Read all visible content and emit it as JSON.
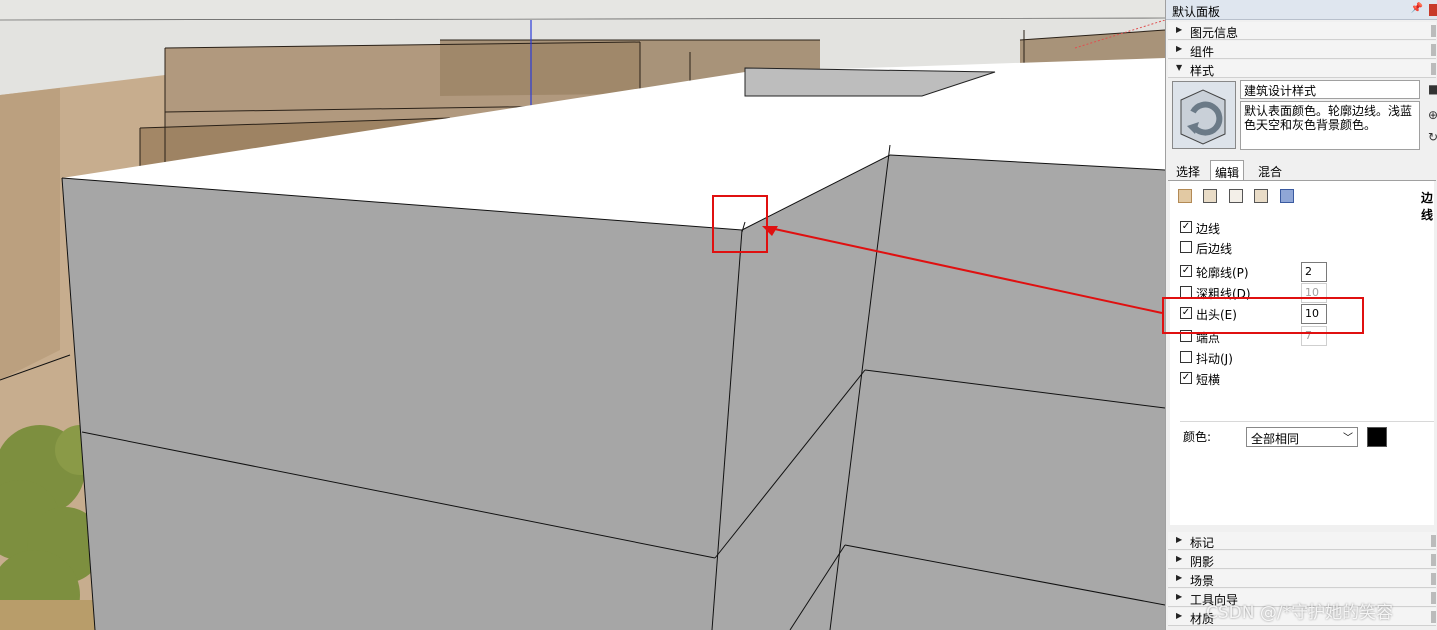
{
  "panel": {
    "title": "默认面板",
    "pin_icon": "📌",
    "trays_top": [
      {
        "label": "图元信息",
        "state": "collapsed"
      },
      {
        "label": "组件",
        "state": "collapsed"
      },
      {
        "label": "样式",
        "state": "expanded"
      }
    ],
    "style": {
      "name": "建筑设计样式",
      "description": "默认表面颜色。轮廓边线。浅蓝色天空和灰色背景颜色。"
    },
    "tabs": [
      {
        "label": "选择",
        "active": false
      },
      {
        "label": "编辑",
        "active": true
      },
      {
        "label": "混合",
        "active": false
      }
    ],
    "edit_header": "边线",
    "edge_options": [
      {
        "label": "边线",
        "checked": true
      },
      {
        "label": "后边线",
        "checked": false
      },
      {
        "label": "轮廓线(P)",
        "checked": true,
        "value": "2"
      },
      {
        "label": "深粗线(D)",
        "checked": false,
        "value": "10",
        "disabled": true
      },
      {
        "label": "出头(E)",
        "checked": true,
        "value": "10"
      },
      {
        "label": "端点",
        "checked": false,
        "value": "7",
        "disabled": true
      },
      {
        "label": "抖动(J)",
        "checked": false
      },
      {
        "label": "短横",
        "checked": true
      }
    ],
    "color_label": "颜色:",
    "color_mode": "全部相同",
    "color_swatch": "#000000",
    "trays_bottom": [
      {
        "label": "标记",
        "state": "collapsed"
      },
      {
        "label": "阴影",
        "state": "collapsed"
      },
      {
        "label": "场景",
        "state": "collapsed"
      },
      {
        "label": "工具向导",
        "state": "collapsed"
      },
      {
        "label": "材质",
        "state": "collapsed"
      }
    ]
  },
  "watermark": "CSDN @/*守护她的笑容",
  "colors": {
    "annotation_red": "#e01010",
    "wall_gray": "#a6a6a6",
    "roof_white": "#ffffff"
  }
}
